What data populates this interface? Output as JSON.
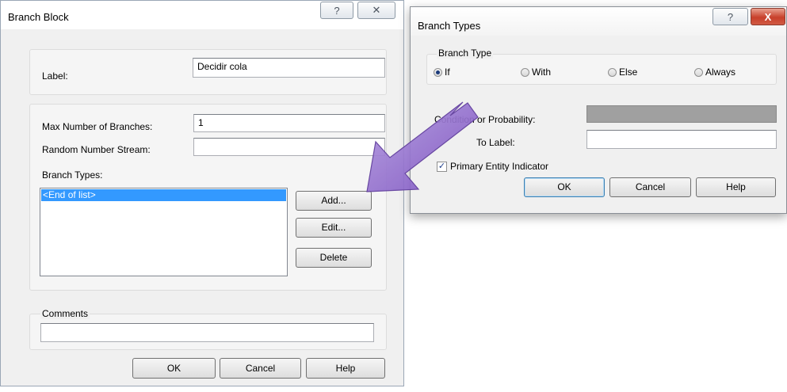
{
  "branch_block": {
    "title": "Branch Block",
    "help_glyph": "?",
    "close_glyph": "✕",
    "label_caption": "Label:",
    "label_value": "Decidir cola",
    "max_branches_caption": "Max Number of Branches:",
    "max_branches_value": "1",
    "random_stream_caption": "Random Number Stream:",
    "random_stream_value": "",
    "branch_types_caption": "Branch Types:",
    "branch_types_list": [
      "<End of list>"
    ],
    "add_label": "Add...",
    "edit_label": "Edit...",
    "delete_label": "Delete",
    "comments_caption": "Comments",
    "comments_value": "",
    "ok_label": "OK",
    "cancel_label": "Cancel",
    "help_label": "Help"
  },
  "branch_types": {
    "title": "Branch Types",
    "help_glyph": "?",
    "close_glyph": "X",
    "group_caption": "Branch Type",
    "radio_if": "If",
    "radio_with": "With",
    "radio_else": "Else",
    "radio_always": "Always",
    "selected_type": "If",
    "condition_caption": "Condition or Probability:",
    "condition_value": "",
    "goto_caption": "To Label:",
    "goto_value": "",
    "primary_entity_label": "Primary Entity Indicator",
    "primary_entity_checked": true,
    "ok_label": "OK",
    "cancel_label": "Cancel",
    "help_label": "Help"
  },
  "colors": {
    "arrow_fill": "#8a63c8",
    "selection": "#3399ff",
    "dialog_bg": "#f0f0f0"
  },
  "icons": {
    "arrow": "annotation-arrow-icon"
  }
}
